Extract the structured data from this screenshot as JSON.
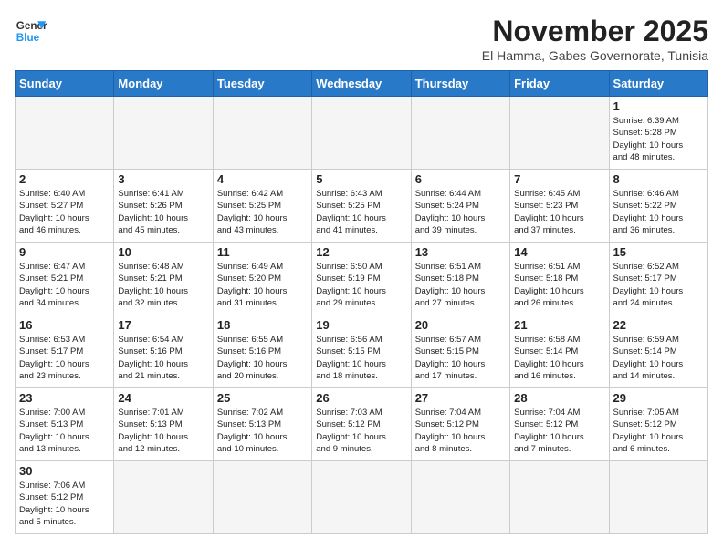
{
  "header": {
    "logo_general": "General",
    "logo_blue": "Blue",
    "month": "November 2025",
    "location": "El Hamma, Gabes Governorate, Tunisia"
  },
  "weekdays": [
    "Sunday",
    "Monday",
    "Tuesday",
    "Wednesday",
    "Thursday",
    "Friday",
    "Saturday"
  ],
  "weeks": [
    [
      {
        "day": "",
        "info": ""
      },
      {
        "day": "",
        "info": ""
      },
      {
        "day": "",
        "info": ""
      },
      {
        "day": "",
        "info": ""
      },
      {
        "day": "",
        "info": ""
      },
      {
        "day": "",
        "info": ""
      },
      {
        "day": "1",
        "info": "Sunrise: 6:39 AM\nSunset: 5:28 PM\nDaylight: 10 hours\nand 48 minutes."
      }
    ],
    [
      {
        "day": "2",
        "info": "Sunrise: 6:40 AM\nSunset: 5:27 PM\nDaylight: 10 hours\nand 46 minutes."
      },
      {
        "day": "3",
        "info": "Sunrise: 6:41 AM\nSunset: 5:26 PM\nDaylight: 10 hours\nand 45 minutes."
      },
      {
        "day": "4",
        "info": "Sunrise: 6:42 AM\nSunset: 5:25 PM\nDaylight: 10 hours\nand 43 minutes."
      },
      {
        "day": "5",
        "info": "Sunrise: 6:43 AM\nSunset: 5:25 PM\nDaylight: 10 hours\nand 41 minutes."
      },
      {
        "day": "6",
        "info": "Sunrise: 6:44 AM\nSunset: 5:24 PM\nDaylight: 10 hours\nand 39 minutes."
      },
      {
        "day": "7",
        "info": "Sunrise: 6:45 AM\nSunset: 5:23 PM\nDaylight: 10 hours\nand 37 minutes."
      },
      {
        "day": "8",
        "info": "Sunrise: 6:46 AM\nSunset: 5:22 PM\nDaylight: 10 hours\nand 36 minutes."
      }
    ],
    [
      {
        "day": "9",
        "info": "Sunrise: 6:47 AM\nSunset: 5:21 PM\nDaylight: 10 hours\nand 34 minutes."
      },
      {
        "day": "10",
        "info": "Sunrise: 6:48 AM\nSunset: 5:21 PM\nDaylight: 10 hours\nand 32 minutes."
      },
      {
        "day": "11",
        "info": "Sunrise: 6:49 AM\nSunset: 5:20 PM\nDaylight: 10 hours\nand 31 minutes."
      },
      {
        "day": "12",
        "info": "Sunrise: 6:50 AM\nSunset: 5:19 PM\nDaylight: 10 hours\nand 29 minutes."
      },
      {
        "day": "13",
        "info": "Sunrise: 6:51 AM\nSunset: 5:18 PM\nDaylight: 10 hours\nand 27 minutes."
      },
      {
        "day": "14",
        "info": "Sunrise: 6:51 AM\nSunset: 5:18 PM\nDaylight: 10 hours\nand 26 minutes."
      },
      {
        "day": "15",
        "info": "Sunrise: 6:52 AM\nSunset: 5:17 PM\nDaylight: 10 hours\nand 24 minutes."
      }
    ],
    [
      {
        "day": "16",
        "info": "Sunrise: 6:53 AM\nSunset: 5:17 PM\nDaylight: 10 hours\nand 23 minutes."
      },
      {
        "day": "17",
        "info": "Sunrise: 6:54 AM\nSunset: 5:16 PM\nDaylight: 10 hours\nand 21 minutes."
      },
      {
        "day": "18",
        "info": "Sunrise: 6:55 AM\nSunset: 5:16 PM\nDaylight: 10 hours\nand 20 minutes."
      },
      {
        "day": "19",
        "info": "Sunrise: 6:56 AM\nSunset: 5:15 PM\nDaylight: 10 hours\nand 18 minutes."
      },
      {
        "day": "20",
        "info": "Sunrise: 6:57 AM\nSunset: 5:15 PM\nDaylight: 10 hours\nand 17 minutes."
      },
      {
        "day": "21",
        "info": "Sunrise: 6:58 AM\nSunset: 5:14 PM\nDaylight: 10 hours\nand 16 minutes."
      },
      {
        "day": "22",
        "info": "Sunrise: 6:59 AM\nSunset: 5:14 PM\nDaylight: 10 hours\nand 14 minutes."
      }
    ],
    [
      {
        "day": "23",
        "info": "Sunrise: 7:00 AM\nSunset: 5:13 PM\nDaylight: 10 hours\nand 13 minutes."
      },
      {
        "day": "24",
        "info": "Sunrise: 7:01 AM\nSunset: 5:13 PM\nDaylight: 10 hours\nand 12 minutes."
      },
      {
        "day": "25",
        "info": "Sunrise: 7:02 AM\nSunset: 5:13 PM\nDaylight: 10 hours\nand 10 minutes."
      },
      {
        "day": "26",
        "info": "Sunrise: 7:03 AM\nSunset: 5:12 PM\nDaylight: 10 hours\nand 9 minutes."
      },
      {
        "day": "27",
        "info": "Sunrise: 7:04 AM\nSunset: 5:12 PM\nDaylight: 10 hours\nand 8 minutes."
      },
      {
        "day": "28",
        "info": "Sunrise: 7:04 AM\nSunset: 5:12 PM\nDaylight: 10 hours\nand 7 minutes."
      },
      {
        "day": "29",
        "info": "Sunrise: 7:05 AM\nSunset: 5:12 PM\nDaylight: 10 hours\nand 6 minutes."
      }
    ],
    [
      {
        "day": "30",
        "info": "Sunrise: 7:06 AM\nSunset: 5:12 PM\nDaylight: 10 hours\nand 5 minutes."
      },
      {
        "day": "",
        "info": ""
      },
      {
        "day": "",
        "info": ""
      },
      {
        "day": "",
        "info": ""
      },
      {
        "day": "",
        "info": ""
      },
      {
        "day": "",
        "info": ""
      },
      {
        "day": "",
        "info": ""
      }
    ]
  ]
}
